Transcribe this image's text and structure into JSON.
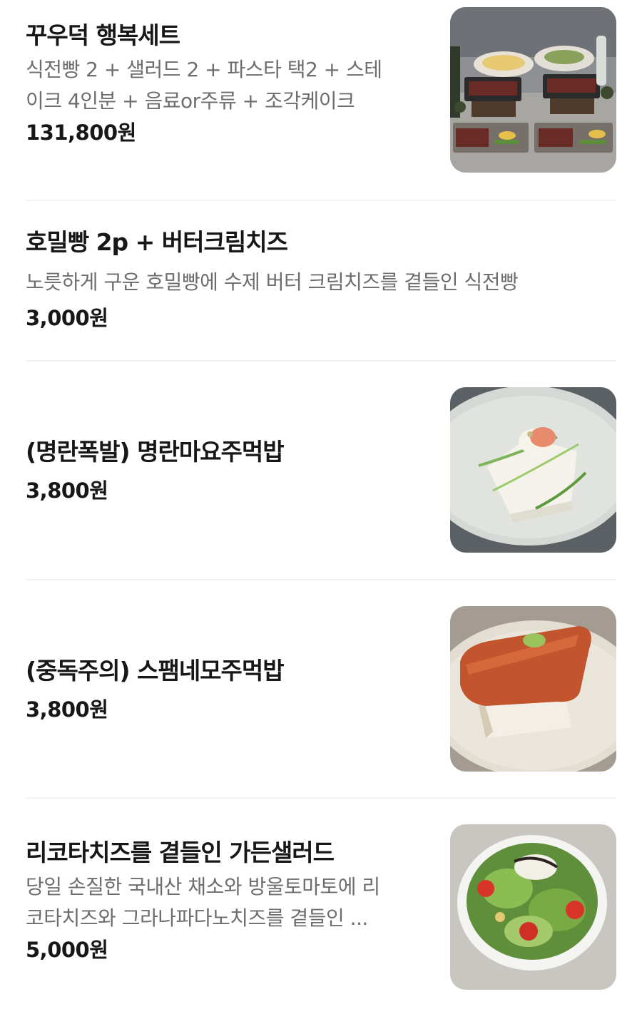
{
  "menu_items": [
    {
      "name": "꾸우덕 행복세트",
      "desc_line1": "식전빵 2 + 샐러드 2 + 파스타 택2 + 스테",
      "desc_line2": "이크 4인분 + 음료or주류 + 조각케이크",
      "price": "131,800원",
      "image_alt": "steak set platter"
    },
    {
      "name": "호밀빵 2p + 버터크림치즈",
      "desc_line1": "노릇하게 구운 호밀빵에 수제 버터 크림치즈를 곁들인 식전빵",
      "price": "3,000원"
    },
    {
      "name": "(명란폭발) 명란마요주먹밥",
      "price": "3,800원",
      "image_alt": "mentaiko mayo rice ball"
    },
    {
      "name": "(중독주의) 스팸네모주먹밥",
      "price": "3,800원",
      "image_alt": "spam rice block"
    },
    {
      "name": "리코타치즈를 곁들인 가든샐러드",
      "desc_line1": "당일 손질한 국내산 채소와 방울토마토에 리",
      "desc_line2": "코타치즈와 그라나파다노치즈를 곁들인 ...",
      "price": "5,000원",
      "image_alt": "garden salad with ricotta"
    }
  ],
  "colors": {
    "text_primary": "#171717",
    "text_secondary": "#6d6d6d",
    "divider": "#f1f1f1",
    "background": "#ffffff"
  }
}
